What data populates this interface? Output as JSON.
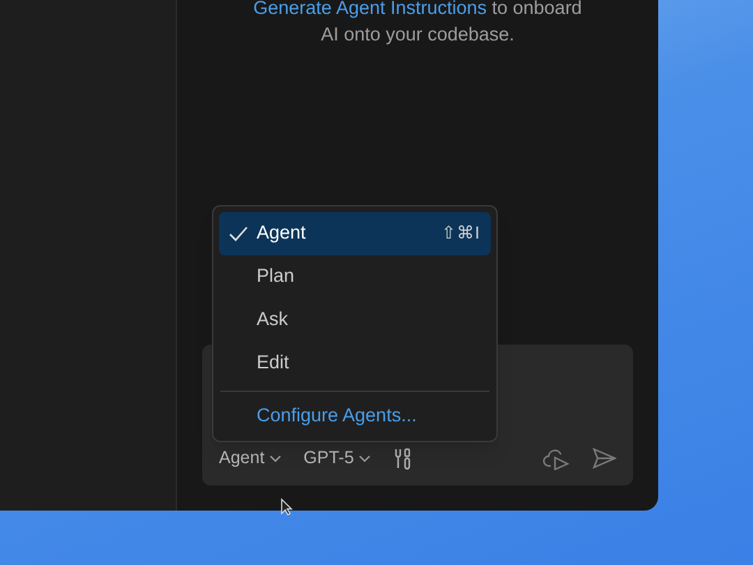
{
  "hint": {
    "link": "Generate Agent Instructions",
    "text": " to onboard AI onto your codebase."
  },
  "mode_menu": {
    "items": [
      {
        "label": "Agent",
        "selected": true,
        "shortcut": "⇧⌘I"
      },
      {
        "label": "Plan",
        "selected": false
      },
      {
        "label": "Ask",
        "selected": false
      },
      {
        "label": "Edit",
        "selected": false
      }
    ],
    "action": "Configure Agents..."
  },
  "toolbar": {
    "mode": "Agent",
    "model": "GPT-5"
  }
}
